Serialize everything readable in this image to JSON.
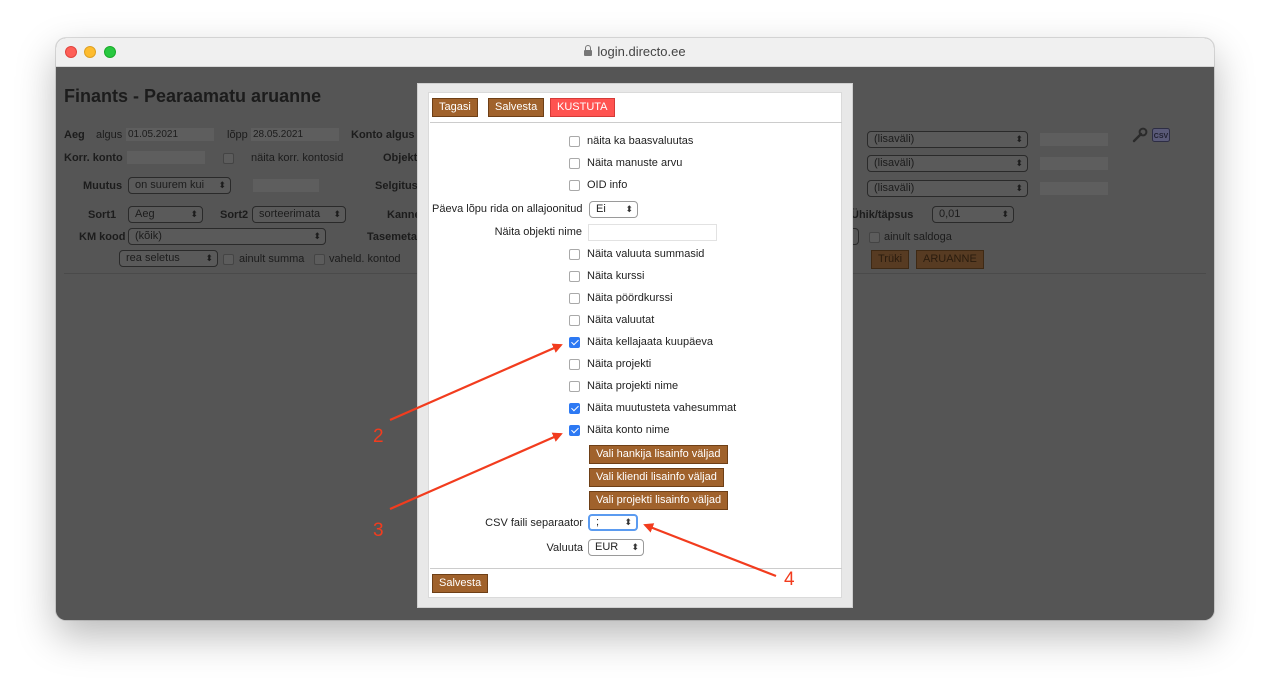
{
  "browser": {
    "url": "login.directo.ee"
  },
  "page": {
    "title": "Finants - Pearaamatu aruanne",
    "aeg_label": "Aeg",
    "algus_label": "algus",
    "algus_value": "01.05.2021",
    "lopp_label": "lõpp",
    "lopp_value": "28.05.2021",
    "konto_algus_label": "Konto  algus",
    "korr_konto_label": "Korr. konto",
    "naita_korr_label": "näita korr. kontosid",
    "objekt_label": "Objekt",
    "muutus_label": "Muutus",
    "muutus_value": "on suurem kui",
    "selgitus_label": "Selgitus",
    "sort1_label": "Sort1",
    "sort1_value": "Aeg",
    "sort2_label": "Sort2",
    "sort2_value": "sorteerimata",
    "kanne_label": "Kanne",
    "km_kood_label": "KM kood",
    "km_kood_value": "(kõik)",
    "tasemeta_label": "Tasemeta",
    "rea_seletus_value": "rea seletus",
    "ainult_summa_label": "ainult summa",
    "vaheld_kontod_label": "vaheld. kontod",
    "lisavali_1": "(lisaväli)",
    "lisavali_2": "(lisaväli)",
    "lisavali_3": "(lisaväli)",
    "uhik_label": "Ühik/täpsus",
    "uhik_value": "0,01",
    "ainult_saldoga_label": "ainult saldoga",
    "truki_label": "Trüki",
    "aruanne_label": "ARUANNE"
  },
  "dialog": {
    "tagasi_label": "Tagasi",
    "salvesta_label": "Salvesta",
    "kustuta_label": "KUSTUTA",
    "options": [
      {
        "label": "näita ka baasvaluutas",
        "checked": false
      },
      {
        "label": "Näita manuste arvu",
        "checked": false
      },
      {
        "label": "OID info",
        "checked": false
      }
    ],
    "paeva_label": "Päeva lõpu rida on allajoonitud",
    "paeva_value": "Ei",
    "objekti_nime_label": "Näita objekti nime",
    "options2": [
      {
        "label": "Näita valuuta summasid",
        "checked": false
      },
      {
        "label": "Näita kurssi",
        "checked": false
      },
      {
        "label": "Näita pöördkurssi",
        "checked": false
      },
      {
        "label": "Näita valuutat",
        "checked": false
      },
      {
        "label": "Näita kellajaata kuupäeva",
        "checked": true
      },
      {
        "label": "Näita projekti",
        "checked": false
      },
      {
        "label": "Näita projekti nime",
        "checked": false
      },
      {
        "label": "Näita muutusteta vahesummat",
        "checked": true
      },
      {
        "label": "Näita konto nime",
        "checked": true
      }
    ],
    "hankija_btn": "Vali hankija lisainfo väljad",
    "kliendi_btn": "Vali kliendi lisainfo väljad",
    "projekti_btn": "Vali projekti lisainfo väljad",
    "csv_label": "CSV faili separaator",
    "csv_value": ";",
    "valuuta_label": "Valuuta",
    "valuuta_value": "EUR",
    "salvesta_bottom": "Salvesta"
  },
  "annotations": {
    "a2": "2",
    "a3": "3",
    "a4": "4",
    "color": "#f23c1e"
  }
}
